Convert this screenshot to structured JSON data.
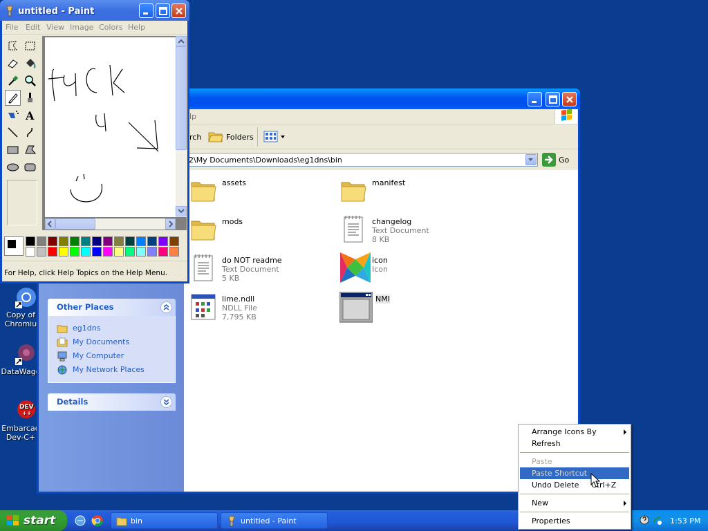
{
  "desktop": {
    "icons": [
      {
        "label_line1": "Copy of",
        "label_line2": "Chromiu"
      },
      {
        "label_line1": "DataWago",
        "label_line2": ""
      },
      {
        "label_line1": "Embarcad",
        "label_line2": "Dev-C+"
      }
    ]
  },
  "paint": {
    "title": "untitled - Paint",
    "menu": [
      "File",
      "Edit",
      "View",
      "Image",
      "Colors",
      "Help"
    ],
    "status": "For Help, click Help Topics on the Help Menu.",
    "palette_top": [
      "#000000",
      "#808080",
      "#800000",
      "#808000",
      "#008000",
      "#008080",
      "#000080",
      "#800080",
      "#808040",
      "#004040",
      "#0080ff",
      "#004080",
      "#8000ff",
      "#804000"
    ],
    "palette_bottom": [
      "#ffffff",
      "#c0c0c0",
      "#ff0000",
      "#ffff00",
      "#00ff00",
      "#00ffff",
      "#0000ff",
      "#ff00ff",
      "#ffff80",
      "#00ff80",
      "#80ffff",
      "#8080ff",
      "#ff0080",
      "#ff8040"
    ]
  },
  "explorer": {
    "menu_partial": "lp",
    "toolbar": {
      "search_partial": "rch",
      "folders": "Folders"
    },
    "address": "2\\My Documents\\Downloads\\eg1dns\\bin",
    "go": "Go",
    "other_places": {
      "title": "Other Places",
      "links": [
        "eg1dns",
        "My Documents",
        "My Computer",
        "My Network Places"
      ]
    },
    "details": {
      "title": "Details"
    },
    "files": [
      {
        "name": "assets",
        "type": "",
        "size": "",
        "icon": "folder-icon"
      },
      {
        "name": "manifest",
        "type": "",
        "size": "",
        "icon": "folder-icon"
      },
      {
        "name": "mods",
        "type": "",
        "size": "",
        "icon": "folder-icon"
      },
      {
        "name": "changelog",
        "type": "Text Document",
        "size": "8 KB",
        "icon": "text-document-icon"
      },
      {
        "name": "do NOT readme",
        "type": "Text Document",
        "size": "5 KB",
        "icon": "text-document-icon"
      },
      {
        "name": "icon",
        "type": "Icon",
        "size": "",
        "icon": "haxe-icon"
      },
      {
        "name": "lime.ndll",
        "type": "NDLL File",
        "size": "7,795 KB",
        "icon": "ndll-file-icon"
      },
      {
        "name": "NMI",
        "type": "",
        "size": "",
        "icon": "application-icon"
      }
    ]
  },
  "context_menu": {
    "arrange": "Arrange Icons By",
    "refresh": "Refresh",
    "paste": "Paste",
    "paste_shortcut": "Paste Shortcut",
    "undo_delete": "Undo Delete",
    "undo_shortcut": "Ctrl+Z",
    "new": "New",
    "properties": "Properties"
  },
  "taskbar": {
    "start": "start",
    "tasks": [
      "bin",
      "untitled - Paint"
    ],
    "clock": "1:53 PM"
  }
}
